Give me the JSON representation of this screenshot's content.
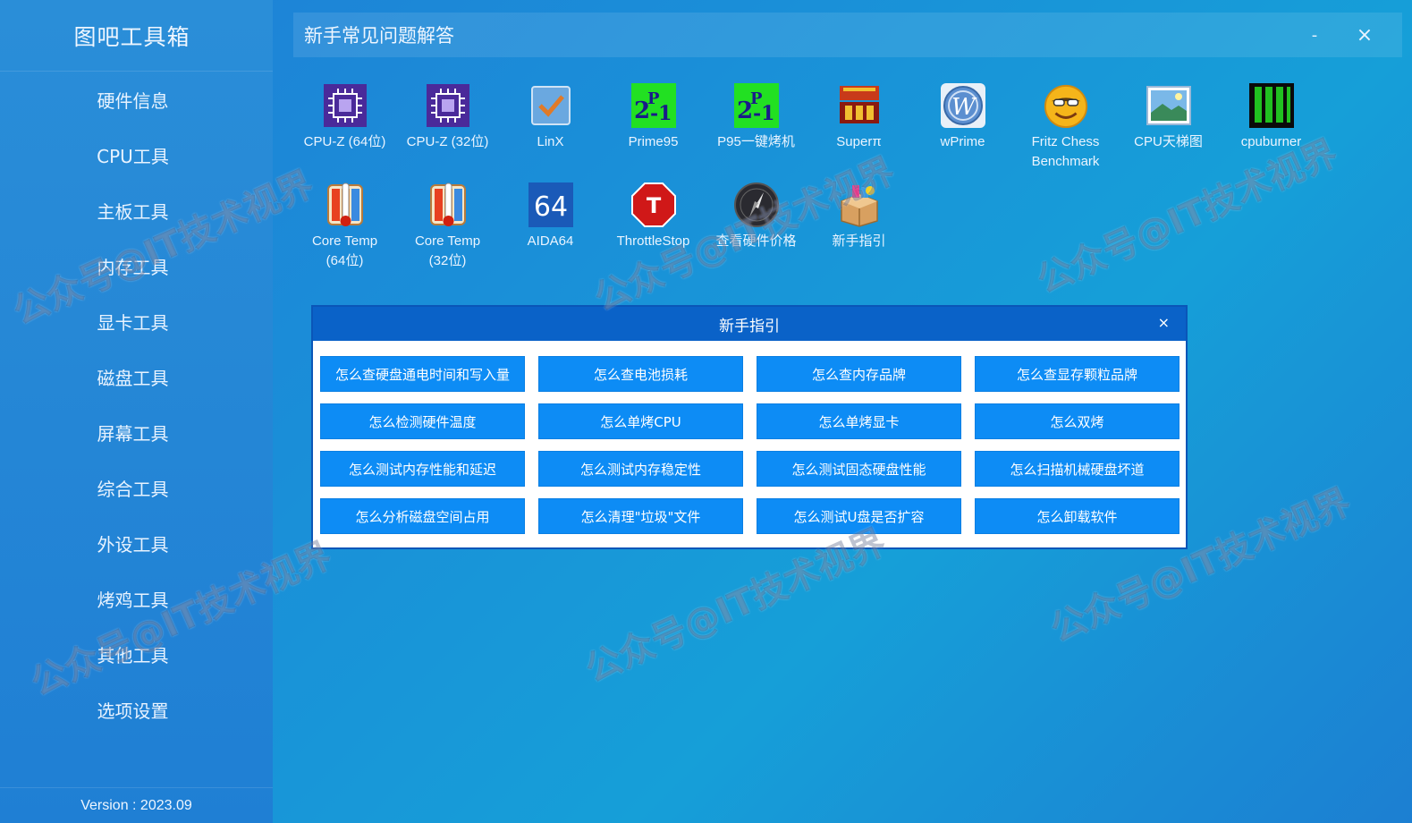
{
  "app": {
    "title": "图吧工具箱",
    "version": "Version : 2023.09"
  },
  "sidebar": {
    "items": [
      {
        "label": "硬件信息"
      },
      {
        "label": "CPU工具"
      },
      {
        "label": "主板工具"
      },
      {
        "label": "内存工具"
      },
      {
        "label": "显卡工具"
      },
      {
        "label": "磁盘工具"
      },
      {
        "label": "屏幕工具"
      },
      {
        "label": "综合工具"
      },
      {
        "label": "外设工具"
      },
      {
        "label": "烤鸡工具"
      },
      {
        "label": "其他工具"
      },
      {
        "label": "选项设置"
      }
    ]
  },
  "header": {
    "title": "新手常见问题解答",
    "minimize": "-",
    "close": "×"
  },
  "tools": [
    {
      "label": "CPU-Z (64位)",
      "icon": "cpu-z-icon"
    },
    {
      "label": "CPU-Z (32位)",
      "icon": "cpu-z-icon"
    },
    {
      "label": "LinX",
      "icon": "linx-checkbox-icon"
    },
    {
      "label": "Prime95",
      "icon": "prime95-icon",
      "glyph": "2P-1"
    },
    {
      "label": "P95一键烤机",
      "icon": "prime95-icon",
      "glyph": "2P-1"
    },
    {
      "label": "Superπ",
      "icon": "superpi-icon"
    },
    {
      "label": "wPrime",
      "icon": "wprime-icon",
      "glyph": "W"
    },
    {
      "label": "Fritz Chess Benchmark",
      "label_line1": "Fritz Chess",
      "label_line2": "Benchmark",
      "icon": "fritz-chess-icon"
    },
    {
      "label": "CPU天梯图",
      "icon": "cpu-ladder-image-icon"
    },
    {
      "label": "cpuburner",
      "icon": "cpuburner-icon"
    },
    {
      "label": "Core Temp (64位)",
      "label_line1": "Core Temp",
      "label_line2": "(64位)",
      "icon": "thermometer-icon"
    },
    {
      "label": "Core Temp (32位)",
      "label_line1": "Core Temp",
      "label_line2": "(32位)",
      "icon": "thermometer-icon"
    },
    {
      "label": "AIDA64",
      "icon": "aida64-icon",
      "glyph": "64"
    },
    {
      "label": "ThrottleStop",
      "icon": "throttlestop-icon",
      "glyph": "T"
    },
    {
      "label": "查看硬件价格",
      "icon": "price-compass-icon"
    },
    {
      "label": "新手指引",
      "icon": "guide-box-icon"
    }
  ],
  "dialog": {
    "title": "新手指引",
    "close": "×",
    "buttons": [
      {
        "label": "怎么查硬盘通电时间和写入量"
      },
      {
        "label": "怎么查电池损耗"
      },
      {
        "label": "怎么查内存品牌"
      },
      {
        "label": "怎么查显存颗粒品牌"
      },
      {
        "label": "怎么检测硬件温度"
      },
      {
        "label": "怎么单烤CPU"
      },
      {
        "label": "怎么单烤显卡"
      },
      {
        "label": "怎么双烤"
      },
      {
        "label": "怎么测试内存性能和延迟"
      },
      {
        "label": "怎么测试内存稳定性"
      },
      {
        "label": "怎么测试固态硬盘性能"
      },
      {
        "label": "怎么扫描机械硬盘坏道"
      },
      {
        "label": "怎么分析磁盘空间占用"
      },
      {
        "label": "怎么清理\"垃圾\"文件"
      },
      {
        "label": "怎么测试U盘是否扩容"
      },
      {
        "label": "怎么卸载软件"
      }
    ]
  },
  "watermark": "公众号@IT技术视界",
  "colors": {
    "accent": "#0d8cf5",
    "dialog_header": "#0a62c8"
  }
}
